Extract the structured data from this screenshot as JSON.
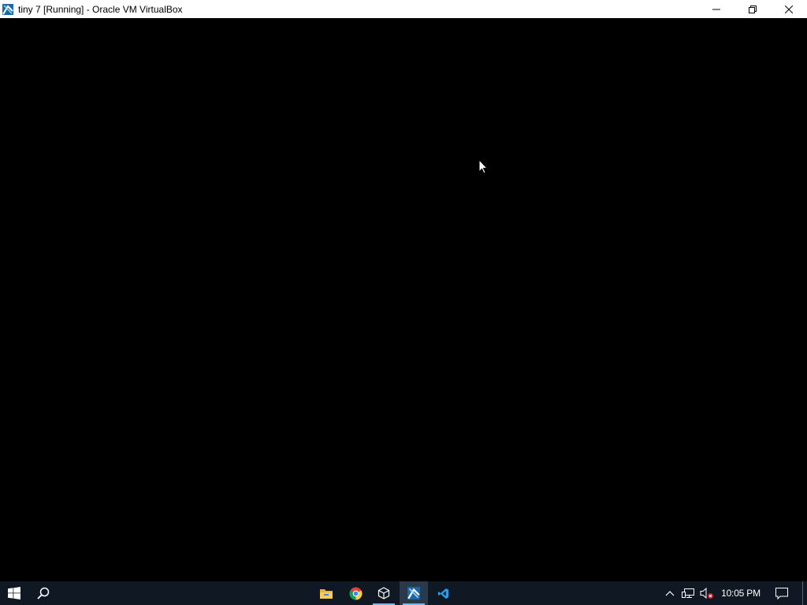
{
  "window": {
    "title": "tiny 7 [Running] - Oracle VM VirtualBox",
    "app_icon": "virtualbox-icon",
    "controls": [
      "minimize-icon",
      "restore-icon",
      "close-icon"
    ]
  },
  "vm_screen": {
    "background": "#000000",
    "pointer": "mouse-pointer-icon"
  },
  "taskbar": {
    "start": "windows-start-icon",
    "search": "search-icon",
    "pinned_apps": [
      {
        "name": "File Explorer",
        "icon": "folder-icon",
        "running": false
      },
      {
        "name": "Google Chrome",
        "icon": "chrome-icon",
        "running": false
      },
      {
        "name": "VirtualBox Manager",
        "icon": "virtualbox-cube-icon",
        "running": true
      },
      {
        "name": "VirtualBox VM",
        "icon": "virtualbox-icon",
        "running": true,
        "active": true
      },
      {
        "name": "Visual Studio Code",
        "icon": "vscode-icon",
        "running": false
      }
    ],
    "tray": {
      "icons": [
        "chevron-up-icon",
        "network-icon",
        "volume-muted-icon"
      ],
      "time": "10:05 PM",
      "notification_icon": "action-center-icon"
    },
    "colors": {
      "background": "#101923",
      "accent": "#76b9ed"
    }
  }
}
